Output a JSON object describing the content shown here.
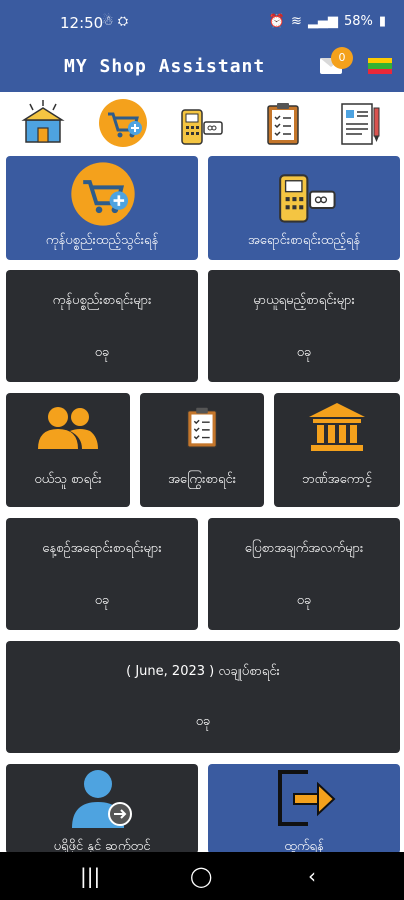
{
  "status": {
    "time": "12:50",
    "left_icons": "☃ ⛭",
    "battery": "58%"
  },
  "header": {
    "title": "MY Shop Assistant",
    "mail_count": "0"
  },
  "cards": {
    "buy_add": "ကုန်ပစ္စည်းထည့်သွင်းရန်",
    "sale_add": "အရောင်းစာရင်းထည့်ရန်",
    "products_list": "ကုန်ပစ္စည်းစာရင်းများ",
    "products_count": "၀ခု",
    "orders_list": "မှာယူရမည့်စာရင်းများ",
    "orders_count": "၀ခု",
    "customers": "ဝယ်သူ စာရင်း",
    "debts": "အကြွေးစာရင်း",
    "bank": "ဘဏ်အကောင့်",
    "daily_sales": "နေ့စဉ်အရောင်းစာရင်းများ",
    "daily_count": "၀ခု",
    "reports": "ပြေစာအချက်အလက်များ",
    "reports_count": "၀ခု",
    "month_prefix": "( June,  2023  )",
    "month_label": "လချုပ်စာရင်း",
    "month_count": "၀ခု",
    "account": "ပရိုဖိုင် နှင့် ဆက်တင်",
    "logout": "ထွက်ရန်"
  },
  "colors": {
    "header_blue": "#3A5BA0",
    "card_dark": "#2B2D31",
    "accent_orange": "#F4A11C"
  }
}
